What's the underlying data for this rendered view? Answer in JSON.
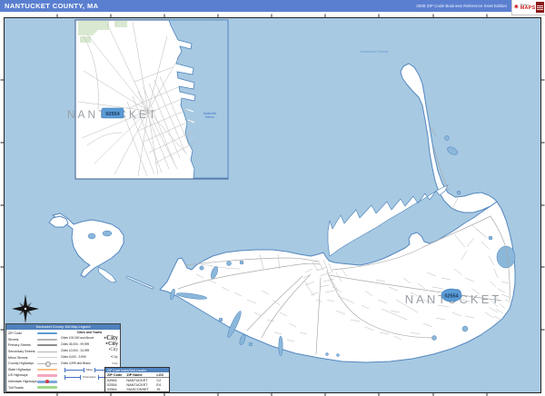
{
  "header": {
    "title": "NANTUCKET COUNTY, MA",
    "edition": "2008 ZIP Code Business Reference Inset Edition"
  },
  "logo": {
    "line1": "Market",
    "line2": "MAPS"
  },
  "map": {
    "island_label": "NANTUCKET",
    "island_zip": "02554",
    "inset_label": "NANTUCKET",
    "inset_zip": "02554",
    "water_label": "Nantucket Sound"
  },
  "legend": {
    "title": "Nantucket County, MA Map Legend",
    "roads": [
      {
        "label": "ZIP Code",
        "color": "#5b9bd5"
      },
      {
        "label": "Streets",
        "color": "#b3b3b3"
      },
      {
        "label": "Primary Streets",
        "color": "#8c8c8c"
      },
      {
        "label": "Secondary Streets",
        "color": "#b3b3b3"
      },
      {
        "label": "Minor Streets",
        "color": "#d0d0d0"
      },
      {
        "label": "County Highways",
        "color": "#b3b3b3"
      },
      {
        "label": "State Highways",
        "color": "#f7c08a"
      },
      {
        "label": "US Highways",
        "color": "#f4a6c0"
      },
      {
        "label": "Interstate Highways",
        "color": "#7da7d9"
      },
      {
        "label": "Toll Roads",
        "color": "#9fd98a"
      }
    ],
    "cities_header": "Cities and Towns",
    "cities": [
      {
        "label": "Cities 100,000 and Above",
        "sample": "City"
      },
      {
        "label": "Cities 35,000 - 99,999",
        "sample": "City"
      },
      {
        "label": "Cities 10,000 - 34,999",
        "sample": "City"
      },
      {
        "label": "Cities 5,000 - 9,999",
        "sample": "City"
      },
      {
        "label": "Cities 4,999 and Below",
        "sample": "City"
      }
    ],
    "scales": [
      "Miles",
      "Kilometers"
    ]
  },
  "zip_table": {
    "title": "ZIP Code Index/Grid Locator",
    "columns": [
      "ZIP Code",
      "ZIP Name",
      "LOC"
    ],
    "rows": [
      [
        "02554",
        "NANTUCKET",
        "C2"
      ],
      [
        "02554",
        "NANTUCKET",
        "E4"
      ],
      [
        "02564",
        "SIASCONSET",
        "J5"
      ]
    ]
  },
  "colors": {
    "water": "#a7c9e2",
    "coastline": "#5588bf",
    "header_bar": "#5b7fd0",
    "panel_bar": "#4f81bd",
    "badge_fill": "#5b9bd5",
    "badge_text": "#17375e",
    "label_gray": "#9aa0a6",
    "road_gray": "#ababab",
    "green_area": "#d9e8d0"
  }
}
